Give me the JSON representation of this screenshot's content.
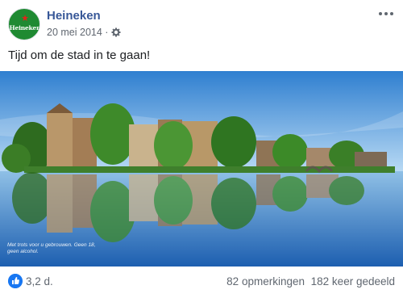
{
  "post": {
    "page_name": "Heineken",
    "avatar_text": "Heineken",
    "date": "20 mei 2014 ·",
    "text": "Tijd om de stad in te gaan!",
    "image_caption": "Met trots voor u gebrouwen. Geen 18, geen alcohol."
  },
  "footer": {
    "reactions": "3,2 d.",
    "comments": "82 opmerkingen",
    "shares": "182 keer gedeeld"
  },
  "icons": {
    "audience": "gear-icon",
    "more": "more-options-icon",
    "like": "thumbs-up-icon"
  },
  "colors": {
    "brand_green": "#1f8a32",
    "link_blue": "#385898",
    "like_blue": "#1877f2"
  }
}
